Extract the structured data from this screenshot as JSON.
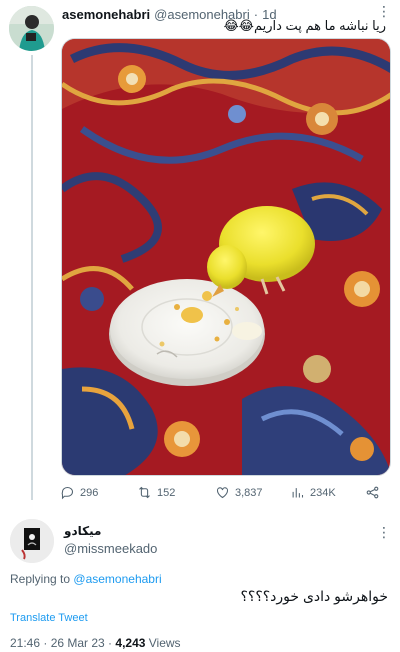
{
  "tweet": {
    "author_name": "asemonehabri",
    "handle": "@asemonehabri",
    "separator": "·",
    "time": "1d",
    "text": "ریا نباشه ما هم پت داریم😂😂",
    "stats": {
      "replies": "296",
      "retweets": "152",
      "likes": "3,837",
      "views": "234K"
    },
    "icons": [
      "reply-icon",
      "retweet-icon",
      "like-icon",
      "views-icon",
      "share-icon",
      "more-icon"
    ]
  },
  "reply": {
    "author_name": "میکادو",
    "handle": "@missmeekado",
    "replying_prefix": "Replying to",
    "replying_to": "@asemonehabri",
    "text": "خواهرشو دادی خورد؟؟؟؟",
    "translate": "Translate Tweet",
    "timestamp": "21:46 · 26 Mar 23 · ",
    "views_count": "4,243",
    "views_label": " Views"
  },
  "colors": {
    "link": "#1d9bf0",
    "muted": "#536471",
    "rug_red": "#a51a22",
    "chick_yellow": "#f2e63a"
  }
}
